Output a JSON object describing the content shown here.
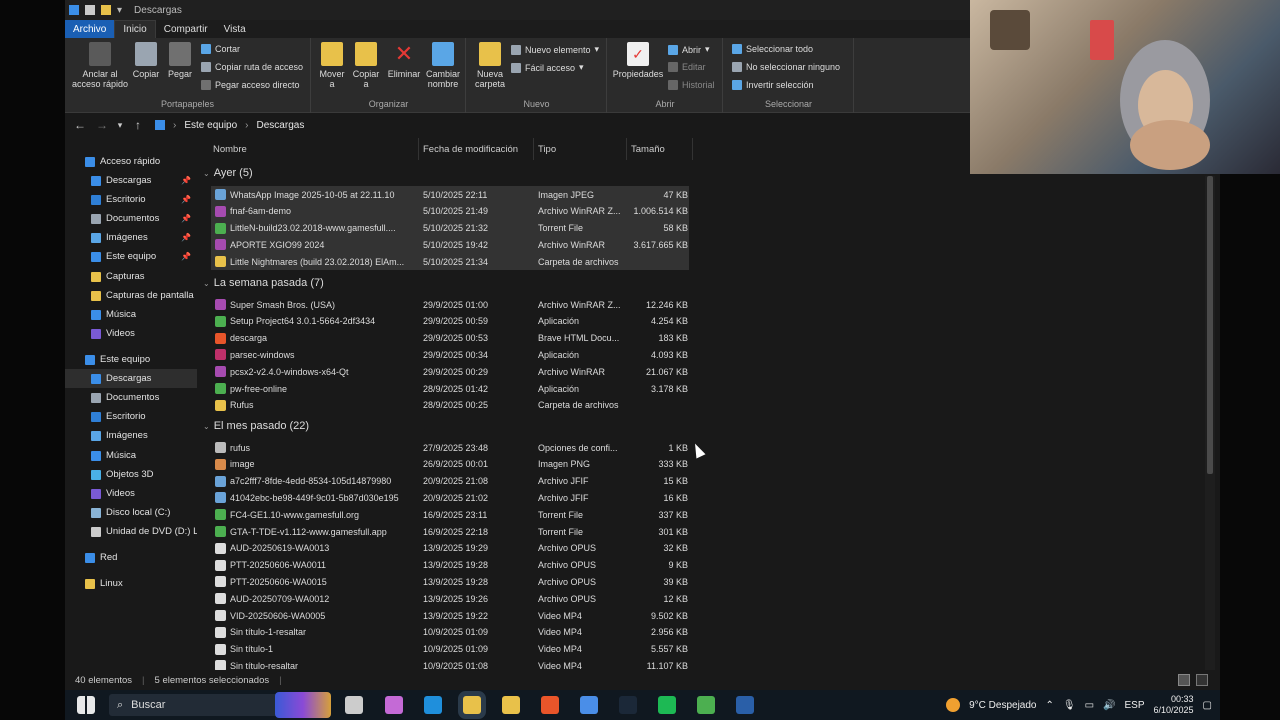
{
  "window": {
    "title": "Descargas"
  },
  "menu_tabs": [
    {
      "label": "Archivo"
    },
    {
      "label": "Inicio"
    },
    {
      "label": "Compartir"
    },
    {
      "label": "Vista"
    }
  ],
  "ribbon": {
    "portapapeles": {
      "label": "Portapapeles",
      "anclar": "Anclar al acceso rápido",
      "copiar": "Copiar",
      "pegar": "Pegar",
      "cortar": "Cortar",
      "copiar_ruta": "Copiar ruta de acceso",
      "pegar_acceso": "Pegar acceso directo"
    },
    "organizar": {
      "label": "Organizar",
      "mover": "Mover a",
      "copiar_a": "Copiar a",
      "eliminar": "Eliminar",
      "cambiar": "Cambiar nombre"
    },
    "nuevo": {
      "label": "Nuevo",
      "nueva_carpeta": "Nueva carpeta",
      "nuevo_elemento": "Nuevo elemento",
      "facil_acceso": "Fácil acceso"
    },
    "abrir": {
      "label": "Abrir",
      "propiedades": "Propiedades",
      "abrir": "Abrir",
      "editar": "Editar",
      "historial": "Historial"
    },
    "seleccionar": {
      "label": "Seleccionar",
      "todo": "Seleccionar todo",
      "ninguno": "No seleccionar ninguno",
      "invertir": "Invertir selección"
    }
  },
  "address": {
    "crumbs": [
      "Este equipo",
      "Descargas"
    ]
  },
  "sidebar": [
    {
      "label": "Acceso rápido",
      "icon": "star-icon",
      "color": "#3b8ee8",
      "indent": 0,
      "pin": false
    },
    {
      "label": "Descargas",
      "icon": "download-icon",
      "color": "#3b8ee8",
      "indent": 1,
      "pin": true
    },
    {
      "label": "Escritorio",
      "icon": "desktop-icon",
      "color": "#2f7fd6",
      "indent": 1,
      "pin": true
    },
    {
      "label": "Documentos",
      "icon": "documents-icon",
      "color": "#9aa5b1",
      "indent": 1,
      "pin": true
    },
    {
      "label": "Imágenes",
      "icon": "pictures-icon",
      "color": "#5aa6e6",
      "indent": 1,
      "pin": true
    },
    {
      "label": "Este equipo",
      "icon": "computer-icon",
      "color": "#3b8ee8",
      "indent": 1,
      "pin": true
    },
    {
      "label": "Capturas",
      "icon": "folder-icon",
      "color": "#e8c14a",
      "indent": 1,
      "pin": false
    },
    {
      "label": "Capturas de pantalla",
      "icon": "folder-icon",
      "color": "#e8c14a",
      "indent": 1,
      "pin": false
    },
    {
      "label": "Música",
      "icon": "music-icon",
      "color": "#3b8ee8",
      "indent": 1,
      "pin": false
    },
    {
      "label": "Videos",
      "icon": "videos-icon",
      "color": "#7a5ad6",
      "indent": 1,
      "pin": false
    },
    {
      "label": "Este equipo",
      "icon": "computer-icon",
      "color": "#3b8ee8",
      "indent": 0,
      "pin": false
    },
    {
      "label": "Descargas",
      "icon": "download-icon",
      "color": "#3b8ee8",
      "indent": 1,
      "pin": false,
      "selected": true
    },
    {
      "label": "Documentos",
      "icon": "documents-icon",
      "color": "#9aa5b1",
      "indent": 1,
      "pin": false
    },
    {
      "label": "Escritorio",
      "icon": "desktop-icon",
      "color": "#2f7fd6",
      "indent": 1,
      "pin": false
    },
    {
      "label": "Imágenes",
      "icon": "pictures-icon",
      "color": "#5aa6e6",
      "indent": 1,
      "pin": false
    },
    {
      "label": "Música",
      "icon": "music-icon",
      "color": "#3b8ee8",
      "indent": 1,
      "pin": false
    },
    {
      "label": "Objetos 3D",
      "icon": "cube-icon",
      "color": "#4ab0e6",
      "indent": 1,
      "pin": false
    },
    {
      "label": "Videos",
      "icon": "videos-icon",
      "color": "#7a5ad6",
      "indent": 1,
      "pin": false
    },
    {
      "label": "Disco local (C:)",
      "icon": "drive-icon",
      "color": "#8ab4d6",
      "indent": 1,
      "pin": false
    },
    {
      "label": "Unidad de DVD (D:) L",
      "icon": "dvd-icon",
      "color": "#cccccc",
      "indent": 1,
      "pin": false
    },
    {
      "label": "Red",
      "icon": "network-icon",
      "color": "#3b8ee8",
      "indent": 0,
      "pin": false
    },
    {
      "label": "Linux",
      "icon": "linux-icon",
      "color": "#e8c14a",
      "indent": 0,
      "pin": false
    }
  ],
  "columns": [
    "Nombre",
    "Fecha de modificación",
    "Tipo",
    "Tamaño"
  ],
  "groups": [
    {
      "header": "Ayer (5)",
      "rows": [
        {
          "name": "WhatsApp Image 2025-10-05 at 22.11.10",
          "date": "5/10/2025 22:11",
          "type": "Imagen JPEG",
          "size": "47 KB",
          "icon": "image-icon",
          "color": "#6aa3d8",
          "selected": true
        },
        {
          "name": "fnaf-6am-demo",
          "date": "5/10/2025 21:49",
          "type": "Archivo WinRAR Z...",
          "size": "1.006.514 KB",
          "icon": "winrar-icon",
          "color": "#a64bb0",
          "selected": true
        },
        {
          "name": "LittleN-build23.02.2018-www.gamesfull....",
          "date": "5/10/2025 21:32",
          "type": "Torrent File",
          "size": "58 KB",
          "icon": "torrent-icon",
          "color": "#4caf50",
          "selected": true
        },
        {
          "name": "APORTE XGIO99 2024",
          "date": "5/10/2025 19:42",
          "type": "Archivo WinRAR",
          "size": "3.617.665 KB",
          "icon": "winrar-icon",
          "color": "#a64bb0",
          "selected": true
        },
        {
          "name": "Little Nightmares (build 23.02.2018) ElAm...",
          "date": "5/10/2025 21:34",
          "type": "Carpeta de archivos",
          "size": "",
          "icon": "folder-icon",
          "color": "#e8c14a",
          "selected": true
        }
      ]
    },
    {
      "header": "La semana pasada (7)",
      "rows": [
        {
          "name": "Super Smash Bros. (USA)",
          "date": "29/9/2025 01:00",
          "type": "Archivo WinRAR Z...",
          "size": "12.246 KB",
          "icon": "winrar-icon",
          "color": "#a64bb0"
        },
        {
          "name": "Setup Project64 3.0.1-5664-2df3434",
          "date": "29/9/2025 00:59",
          "type": "Aplicación",
          "size": "4.254 KB",
          "icon": "app-icon",
          "color": "#4caf50"
        },
        {
          "name": "descarga",
          "date": "29/9/2025 00:53",
          "type": "Brave HTML Docu...",
          "size": "183 KB",
          "icon": "brave-icon",
          "color": "#e8552a"
        },
        {
          "name": "parsec-windows",
          "date": "29/9/2025 00:34",
          "type": "Aplicación",
          "size": "4.093 KB",
          "icon": "app-icon",
          "color": "#c0306a"
        },
        {
          "name": "pcsx2-v2.4.0-windows-x64-Qt",
          "date": "29/9/2025 00:29",
          "type": "Archivo WinRAR",
          "size": "21.067 KB",
          "icon": "winrar-icon",
          "color": "#a64bb0"
        },
        {
          "name": "pw-free-online",
          "date": "28/9/2025 01:42",
          "type": "Aplicación",
          "size": "3.178 KB",
          "icon": "app-icon",
          "color": "#4caf50"
        },
        {
          "name": "Rufus",
          "date": "28/9/2025 00:25",
          "type": "Carpeta de archivos",
          "size": "",
          "icon": "folder-icon",
          "color": "#e8c14a"
        }
      ]
    },
    {
      "header": "El mes pasado (22)",
      "rows": [
        {
          "name": "rufus",
          "date": "27/9/2025 23:48",
          "type": "Opciones de confi...",
          "size": "1 KB",
          "icon": "config-icon",
          "color": "#bbbbbb"
        },
        {
          "name": "image",
          "date": "26/9/2025 00:01",
          "type": "Imagen PNG",
          "size": "333 KB",
          "icon": "image-icon",
          "color": "#d88a4a"
        },
        {
          "name": "a7c2fff7-8fde-4edd-8534-105d14879980",
          "date": "20/9/2025 21:08",
          "type": "Archivo JFIF",
          "size": "15 KB",
          "icon": "image-icon",
          "color": "#6aa3d8"
        },
        {
          "name": "41042ebc-be98-449f-9c01-5b87d030e195",
          "date": "20/9/2025 21:02",
          "type": "Archivo JFIF",
          "size": "16 KB",
          "icon": "image-icon",
          "color": "#6aa3d8"
        },
        {
          "name": "FC4-GE1.10-www.gamesfull.org",
          "date": "16/9/2025 23:11",
          "type": "Torrent File",
          "size": "337 KB",
          "icon": "torrent-icon",
          "color": "#4caf50"
        },
        {
          "name": "GTA-T-TDE-v1.112-www.gamesfull.app",
          "date": "16/9/2025 22:18",
          "type": "Torrent File",
          "size": "301 KB",
          "icon": "torrent-icon",
          "color": "#4caf50"
        },
        {
          "name": "AUD-20250619-WA0013",
          "date": "13/9/2025 19:29",
          "type": "Archivo OPUS",
          "size": "32 KB",
          "icon": "audio-icon",
          "color": "#dddddd"
        },
        {
          "name": "PTT-20250606-WA0011",
          "date": "13/9/2025 19:28",
          "type": "Archivo OPUS",
          "size": "9 KB",
          "icon": "audio-icon",
          "color": "#dddddd"
        },
        {
          "name": "PTT-20250606-WA0015",
          "date": "13/9/2025 19:28",
          "type": "Archivo OPUS",
          "size": "39 KB",
          "icon": "audio-icon",
          "color": "#dddddd"
        },
        {
          "name": "AUD-20250709-WA0012",
          "date": "13/9/2025 19:26",
          "type": "Archivo OPUS",
          "size": "12 KB",
          "icon": "audio-icon",
          "color": "#dddddd"
        },
        {
          "name": "VID-20250606-WA0005",
          "date": "13/9/2025 19:22",
          "type": "Video MP4",
          "size": "9.502 KB",
          "icon": "video-icon",
          "color": "#dddddd"
        },
        {
          "name": "Sin título-1-resaltar",
          "date": "10/9/2025 01:09",
          "type": "Video MP4",
          "size": "2.956 KB",
          "icon": "video-icon",
          "color": "#dddddd"
        },
        {
          "name": "Sin título-1",
          "date": "10/9/2025 01:09",
          "type": "Video MP4",
          "size": "5.557 KB",
          "icon": "video-icon",
          "color": "#dddddd"
        },
        {
          "name": "Sin título-resaltar",
          "date": "10/9/2025 01:08",
          "type": "Video MP4",
          "size": "11.107 KB",
          "icon": "video-icon",
          "color": "#dddddd"
        }
      ]
    }
  ],
  "status": {
    "count": "40 elementos",
    "selected": "5 elementos seleccionados"
  },
  "taskbar": {
    "search": "Buscar",
    "apps": [
      {
        "name": "task-view-icon",
        "color": "#cccccc"
      },
      {
        "name": "copilot-icon",
        "color": "#c46ad6"
      },
      {
        "name": "edge-icon",
        "color": "#1f8fdc"
      },
      {
        "name": "file-explorer-icon",
        "color": "#e8c14a"
      },
      {
        "name": "store-icon",
        "color": "#e8c14a"
      },
      {
        "name": "brave-icon",
        "color": "#e8552a"
      },
      {
        "name": "chrome-icon",
        "color": "#4a8ee8"
      },
      {
        "name": "steam-icon",
        "color": "#1b2838"
      },
      {
        "name": "spotify-icon",
        "color": "#1db954"
      },
      {
        "name": "minecraft-icon",
        "color": "#4caf50"
      },
      {
        "name": "steam-icon",
        "color": "#2a5fa8"
      }
    ],
    "weather": "9°C  Despejado",
    "lang": "ESP",
    "time": "00:33",
    "date": "6/10/2025"
  },
  "colors": {
    "accent": "#1a5fb4",
    "bg": "#191919",
    "selection": "#333333"
  }
}
